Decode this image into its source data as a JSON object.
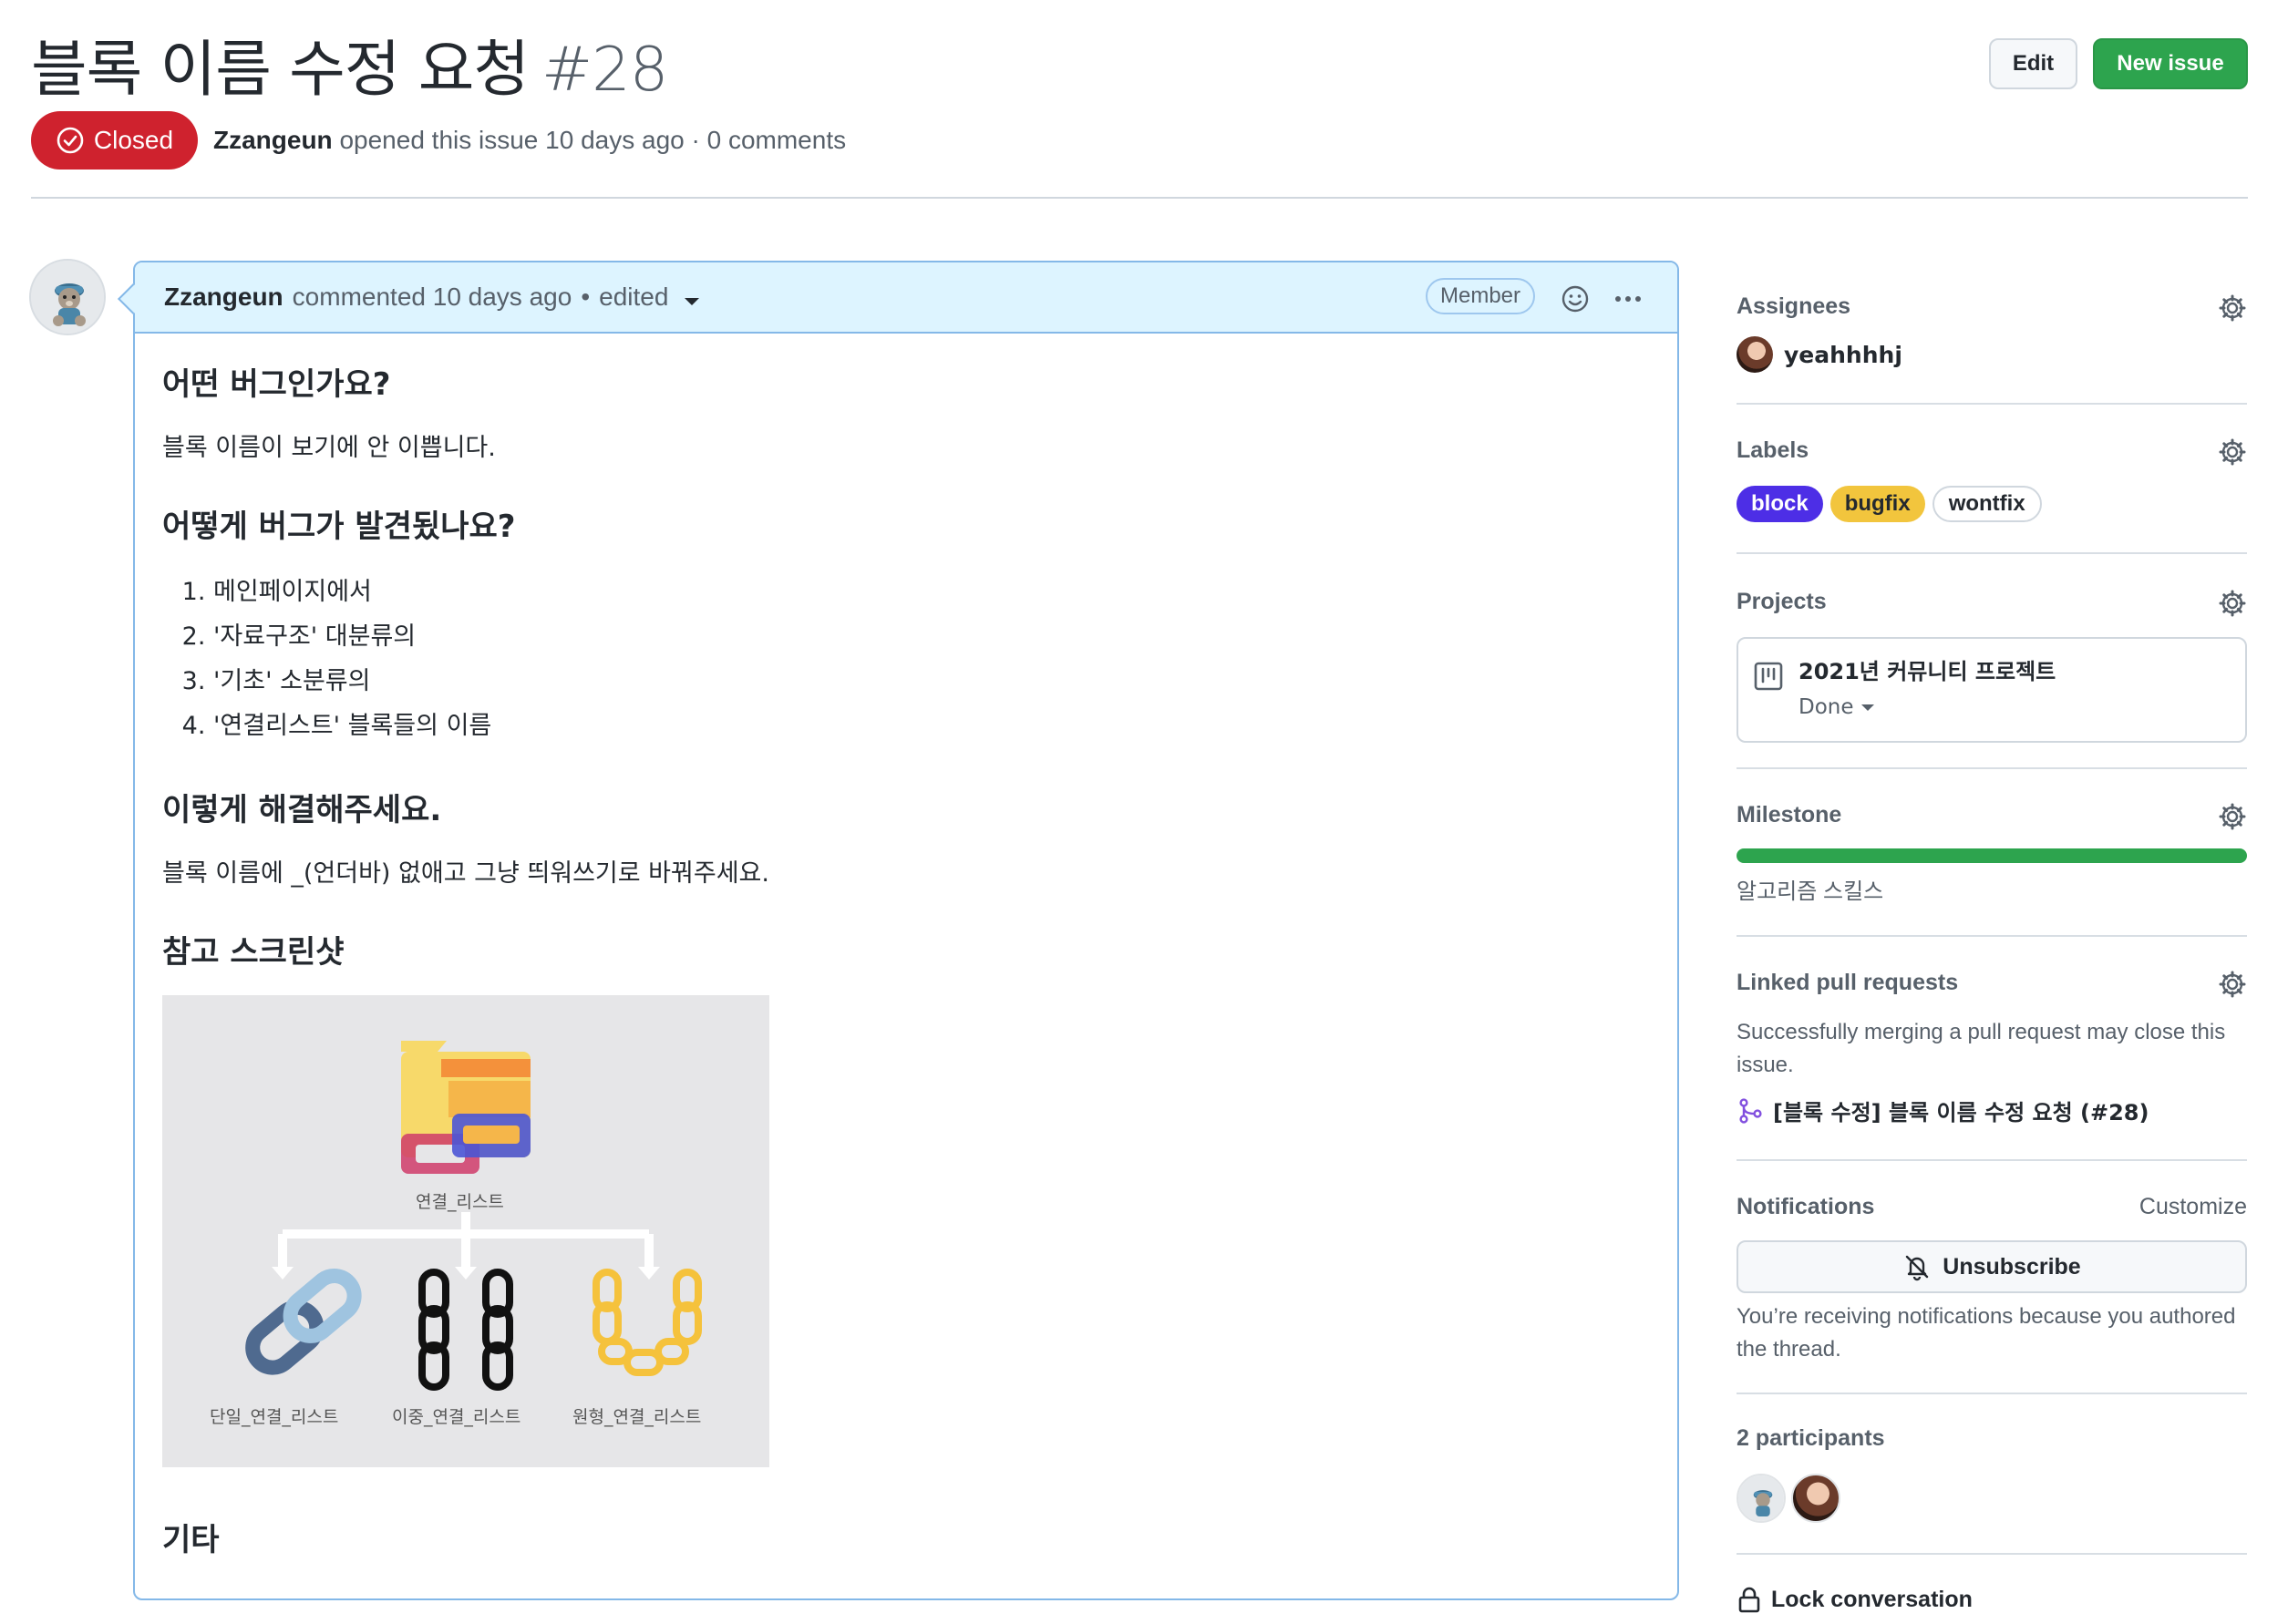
{
  "issue": {
    "title": "블록 이름 수정 요청",
    "number": "#28",
    "state": "Closed",
    "author": "Zzangeun",
    "meta_text": "opened this issue 10 days ago · 0 comments"
  },
  "header_buttons": {
    "edit": "Edit",
    "new_issue": "New issue"
  },
  "comment": {
    "author": "Zzangeun",
    "action": "commented 10 days ago",
    "edited": "edited",
    "role": "Member",
    "sections": {
      "bug_heading": "어떤 버그인가요?",
      "bug_text": "블록 이름이 보기에 안 이쁩니다.",
      "found_heading": "어떻게 버그가 발견됬나요?",
      "steps": [
        "메인페이지에서",
        "'자료구조' 대분류의",
        "'기초' 소분류의",
        "'연결리스트' 블록들의 이름"
      ],
      "fix_heading": "이렇게 해결해주세요.",
      "fix_text": "블록 이름에 _(언더바) 없애고 그냥 띄워쓰기로 바꿔주세요.",
      "screenshot_heading": "참고 스크린샷",
      "other_heading": "기타"
    },
    "image_labels": {
      "root": "연결_리스트",
      "single": "단일_연결_리스트",
      "double": "이중_연결_리스트",
      "circular": "원형_연결_리스트"
    }
  },
  "sidebar": {
    "assignees": {
      "title": "Assignees",
      "user": "yeahhhhj"
    },
    "labels": {
      "title": "Labels",
      "items": [
        {
          "name": "block",
          "bg": "#4d2ee6",
          "fg": "#ffffff"
        },
        {
          "name": "bugfix",
          "bg": "#f2c53d",
          "fg": "#24292f"
        },
        {
          "name": "wontfix",
          "bg": "#ffffff",
          "fg": "#24292f"
        }
      ]
    },
    "projects": {
      "title": "Projects",
      "name": "2021년 커뮤니티 프로젝트",
      "status": "Done"
    },
    "milestone": {
      "title": "Milestone",
      "name": "알고리즘 스킬스",
      "progress": 1.0
    },
    "linked_prs": {
      "title": "Linked pull requests",
      "description": "Successfully merging a pull request may close this issue.",
      "pr": "[블록 수정] 블록 이름 수정 요청 (#28)"
    },
    "notifications": {
      "title": "Notifications",
      "customize": "Customize",
      "button": "Unsubscribe",
      "reason": "You’re receiving notifications because you authored the thread."
    },
    "participants": {
      "title": "2 participants"
    },
    "lock": "Lock conversation"
  },
  "colors": {
    "closed": "#cf222e",
    "primary": "#2da44e",
    "comment_header": "#ddf4ff"
  }
}
